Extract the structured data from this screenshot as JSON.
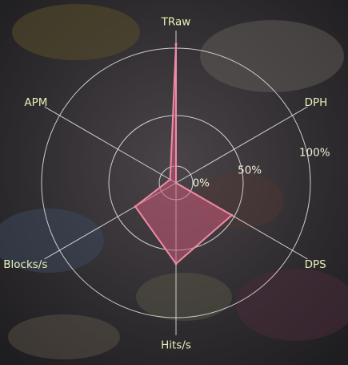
{
  "chart_data": {
    "type": "radar",
    "axes": [
      "TRaw",
      "DPH",
      "DPS",
      "Hits/s",
      "Blocks/s",
      "APM"
    ],
    "series": [
      {
        "values": [
          103,
          0,
          48,
          60,
          35,
          5
        ]
      }
    ],
    "radial_ticks": [
      "0%",
      "50%",
      "100%"
    ],
    "range": [
      0,
      100
    ],
    "grid": true,
    "colors": {
      "fill": "#c85a78",
      "stroke": "#f08aa6",
      "grid": "#e8e8e8",
      "label": "#e9efb8"
    }
  }
}
